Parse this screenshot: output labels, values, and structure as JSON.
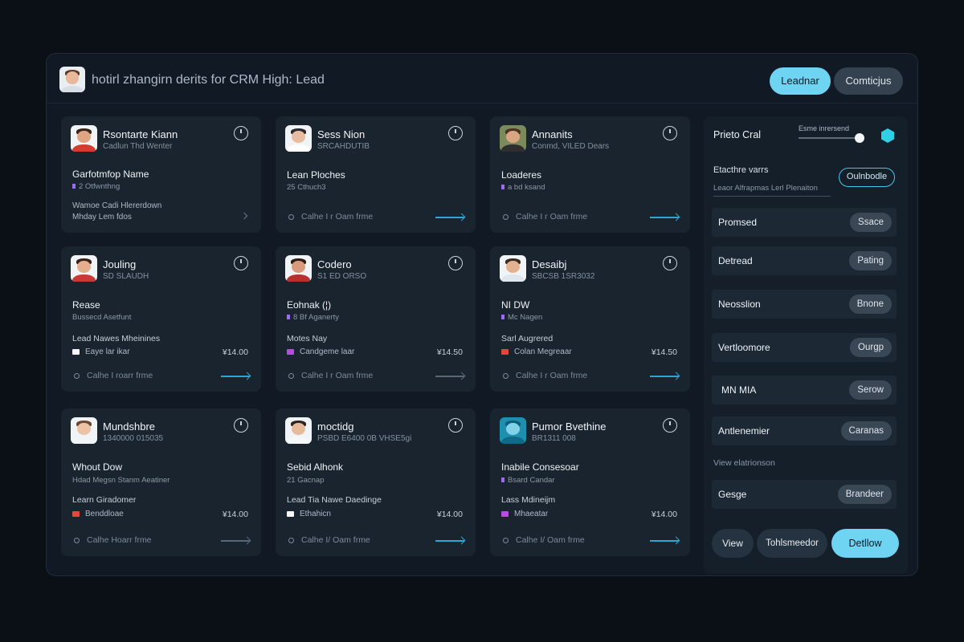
{
  "header": {
    "title": "hotirl zhangirn derits for CRM High: Lead",
    "primary_button": "Leadnar",
    "secondary_button": "Comticjus"
  },
  "cards": [
    {
      "name": "Rsontarte Kiann",
      "sub": "Cadlun Thd Wenter",
      "title": "Garfotmfop Name",
      "tag": "2 Otfwnthng",
      "line1": "Wamoe Cadi Hlererdown",
      "line2": "Mhday Lem fdos",
      "footer": "",
      "amount": ""
    },
    {
      "name": "Sess Nion",
      "sub": "SRCAHDUTIB",
      "title": "Lean Ploches",
      "tag": "25 Cthuch3",
      "line1": "",
      "line2": "",
      "footer": "Calhe I r Oam frme",
      "amount": ""
    },
    {
      "name": "Annanits",
      "sub": "Conmd, VILED Dears",
      "title": "Loaderes",
      "tag": "a bd ksand",
      "line1": "",
      "line2": "",
      "footer": "Calhe I r Oam frme",
      "amount": ""
    },
    {
      "name": "Jouling",
      "sub": "SD SLAUDH",
      "title": "Rease",
      "tag": "Bussecd Asetfunt",
      "line1": "Lead Nawes Mheinines",
      "line2": "Eaye lar ikar",
      "footer": "Calhe I roarr frme",
      "amount": "¥14.00"
    },
    {
      "name": "Codero",
      "sub": "S1 ED ORSO",
      "title": "Eohnak (¦)",
      "tag": "8 Bf Aganerty",
      "line1": "Motes Nay",
      "line2": "Candgeme laar",
      "footer": "Calhe I r Oam frme",
      "amount": "¥14.50"
    },
    {
      "name": "Desaibj",
      "sub": "SBCSB 1SR3032",
      "title": "NI DW",
      "tag": "Mc Nagen",
      "line1": "Sarl Augrered",
      "line2": "Colan Megreaar",
      "footer": "Calhe I r Oam frme",
      "amount": "¥14.50"
    },
    {
      "name": "Mundshbre",
      "sub": "1340000 015035",
      "title": "Whout Dow",
      "tag": "Hdad Megsn Stanm Aeatiner",
      "line1": "Learn Giradomer",
      "line2": "Benddloae",
      "footer": "Calhe Hoarr frme",
      "amount": "¥14.00"
    },
    {
      "name": "moctidg",
      "sub": "PSBD E6400 0B VHSE5gi",
      "title": "Sebid Alhonk",
      "tag": "21 Gacnap",
      "line1": "Lead Tia Nawe Daedinge",
      "line2": "Ethahicn",
      "footer": "Calhe I/ Oam frme",
      "amount": "¥14.00"
    },
    {
      "name": "Pumor Bvethine",
      "sub": "BR1311 008",
      "title": "Inabile Consesoar",
      "tag": "Bsard Candar",
      "line1": "Lass Mdineijm",
      "line2": "Mhaeatar",
      "footer": "Calhe I/ Oam frme",
      "amount": "¥14.00"
    }
  ],
  "panel": {
    "title": "Prieto Cral",
    "slider_label": "Esme inrersend",
    "section_title": "Etacthre varrs",
    "section_input": "Leaor Alfrapmas Lerl Plenaiton",
    "outline_button": "Oulnbodle",
    "rows": [
      {
        "label": "Promsed",
        "button": "Ssace"
      },
      {
        "label": "Detread",
        "button": "Pating"
      },
      {
        "label": "Neosslion",
        "button": "Bnone"
      },
      {
        "label": "Vertloomore",
        "button": "Ourgp"
      },
      {
        "label": "MN MIA",
        "button": "Serow"
      },
      {
        "label": "Antlenemier",
        "button": "Caranas"
      }
    ],
    "view_label": "View elatrionson",
    "bottom_row": {
      "label": "Gesge",
      "button": "Brandeer"
    },
    "btn_view": "View",
    "btn_mid": "Tohlsmeedor",
    "btn_main": "Detllow"
  }
}
